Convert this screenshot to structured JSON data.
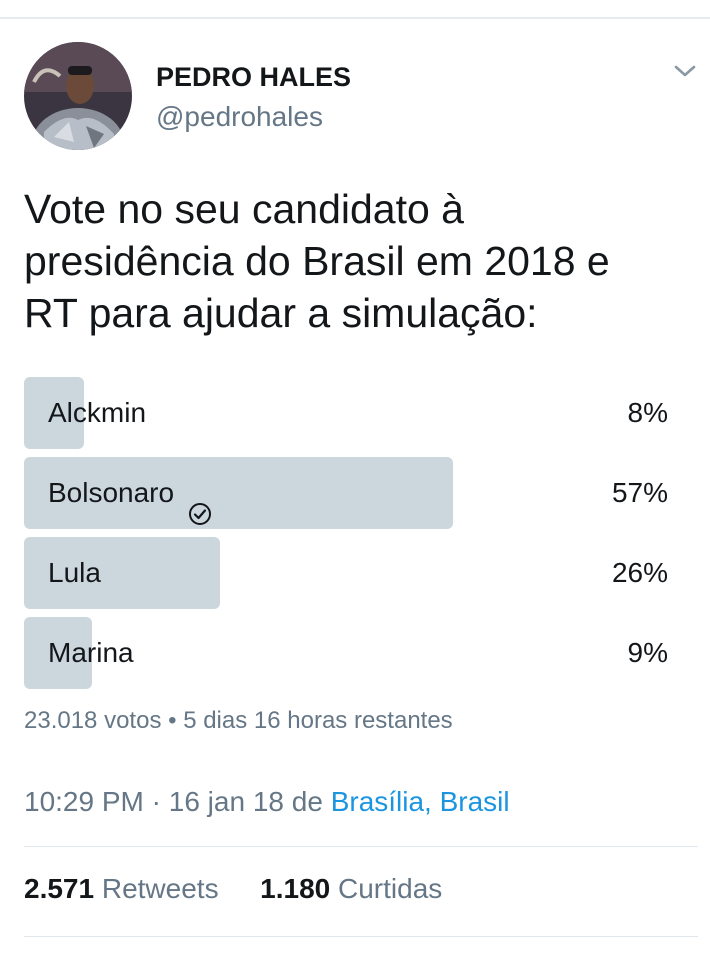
{
  "tweet": {
    "author": {
      "display_name": "PEDRO HALES",
      "handle": "@pedrohales"
    },
    "text": "Vote no seu candidato à\npresidência do Brasil em 2018 e\nRT para ajudar a simulação:",
    "poll": {
      "options": [
        {
          "label": "Alckmin",
          "percent_label": "8%",
          "percent": 8,
          "selected": false
        },
        {
          "label": "Bolsonaro",
          "percent_label": "57%",
          "percent": 57,
          "selected": true
        },
        {
          "label": "Lula",
          "percent_label": "26%",
          "percent": 26,
          "selected": false
        },
        {
          "label": "Marina",
          "percent_label": "9%",
          "percent": 9,
          "selected": false
        }
      ],
      "votes": "23.018 votos",
      "separator": "•",
      "time_remaining": "5 dias 16 horas restantes"
    },
    "time": "10:29 PM",
    "date_separator": "·",
    "date": "16 jan 18",
    "from_label": "de",
    "location": "Brasília, Brasil",
    "stats": {
      "retweets_count": "2.571",
      "retweets_label": "Retweets",
      "likes_count": "1.180",
      "likes_label": "Curtidas"
    }
  },
  "colors": {
    "bar": "#ccd6dd",
    "muted": "#657786",
    "link": "#1b95e0",
    "text": "#14171a"
  },
  "icons": {
    "menu": "chevron-down-icon",
    "selected": "check-circle-icon"
  }
}
